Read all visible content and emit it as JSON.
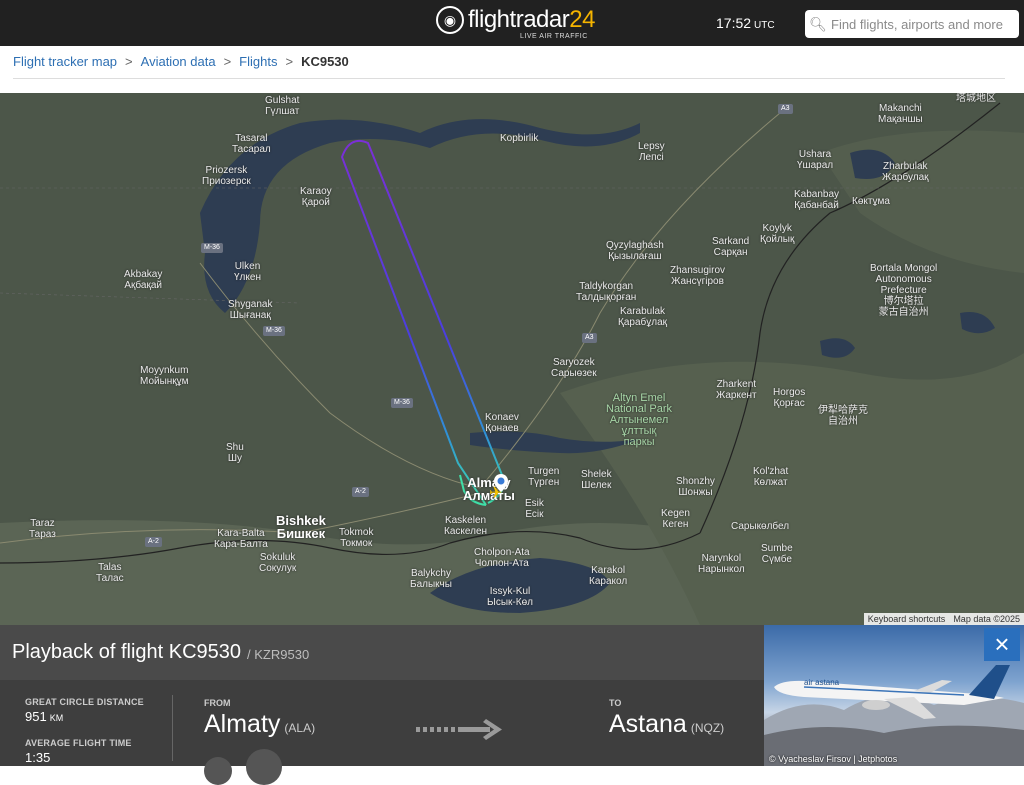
{
  "topbar": {
    "logo_text": "flightradar",
    "logo_num": "24",
    "logo_sub": "LIVE AIR TRAFFIC",
    "time": "17:52",
    "timezone": "UTC",
    "search_placeholder": "Find flights, airports and more"
  },
  "breadcrumb": {
    "items": [
      "Flight tracker map",
      "Aviation data",
      "Flights"
    ],
    "separator": ">",
    "current": "KC9530"
  },
  "map": {
    "labels": {
      "gulshat": "Gulshat\nГүлшат",
      "tasaral": "Tasaral\nТасарал",
      "priozersk": "Priozersk\nПриозерск",
      "karaoy": "Karaoy\nҚарой",
      "kopbirlik": "Kopbirlik",
      "lepsy": "Lepsy\nЛепсі",
      "makanchi": "Makanchi\nМақаншы",
      "urjar": "Ushara\nҮшарал",
      "zharbulak": "Zharbulak\nЖарбулақ",
      "kabanbay": "Kabanbay\nҚабанбай",
      "koktuma": "Көктұма",
      "akbakay": "Akbakay\nАқбақай",
      "ulken": "Ulken\nҮлкен",
      "shyganak": "Shyganak\nШығанақ",
      "qyzylagash": "Qyzylaghash\nҚызылағаш",
      "sarkand": "Sarkand\nСарқан",
      "koylyk": "Koylyk\nҚойлық",
      "zhansugirov": "Zhansugirov\nЖансүгіров",
      "taldykorgan": "Taldykorgan\nТалдықорған",
      "karabulak": "Karabulak\nҚарабұлақ",
      "bortala": "Bortala Mongol\nAutonomous\nPrefecture\n博尔塔拉\n蒙古自治州",
      "moyynkum": "Moyynkum\nМойынқұм",
      "saryozek": "Saryozek\nСарыөзек",
      "altyn_emel": "Altyn Emel\nNational Park\nАлтынемел\nұлттық\nпаркы",
      "zharkent": "Zharkent\nЖаркент",
      "horgos": "Horgos\nҚорғас",
      "ili": "伊犁哈萨克\n自治州",
      "konaev": "Konaev\nҚонаев",
      "shu": "Shu\nШу",
      "almaty": "Almaty\nАлматы",
      "turgen": "Turgen\nТүрген",
      "shelek": "Shelek\nШелек",
      "esik": "Esik\nЕсік",
      "shonzhy": "Shonzhy\nШонжы",
      "kolzhat": "Kol'zhat\nКөлжат",
      "kaskelen": "Kaskelen\nКаскелен",
      "kegen": "Kegen\nКеген",
      "sarykolbel": "Сарыкөлбел",
      "taraz": "Taraz\nТараз",
      "bishkek": "Bishkek\nБишкек",
      "kara_balta": "Kara-Balta\nКара-Балта",
      "sokuluk": "Sokuluk\nСокулук",
      "tokmok": "Tokmok\nТокмок",
      "cholpon_ata": "Cholpon-Ata\nЧолпон-Ата",
      "balykchy": "Balykchy\nБалыкчы",
      "issyk_kul": "Issyk-Kul\nЫсык-Көл",
      "karakol": "Karakol\nКаракол",
      "narynkol": "Narynkol\nНарынкол",
      "sumbe": "Sumbe\nСүмбе",
      "talas": "Talas\nТалас",
      "tacheng": "塔城地区"
    },
    "shields": [
      "A3",
      "M-36",
      "M-36",
      "A3",
      "M-36",
      "A-2",
      "A-2"
    ],
    "attribution": [
      "Keyboard shortcuts",
      "Map data ©2025"
    ]
  },
  "panel": {
    "title": "Playback of flight KC9530",
    "callsign": "/ KZR9530",
    "distance_label": "GREAT CIRCLE DISTANCE",
    "distance_value": "951",
    "distance_unit": "KM",
    "time_label": "AVERAGE FLIGHT TIME",
    "time_value": "1:35",
    "from_label": "FROM",
    "from_city": "Almaty",
    "from_code": "(ALA)",
    "to_label": "TO",
    "to_city": "Astana",
    "to_code": "(NQZ)"
  },
  "photo": {
    "credit": "© Vyacheslav Firsov | Jetphotos",
    "close_icon": "×"
  },
  "colors": {
    "topbar": "#212121",
    "accent": "#f5b400",
    "link": "#2d6fb3",
    "panel": "#3e3e3e",
    "close": "#2a6fbd"
  }
}
